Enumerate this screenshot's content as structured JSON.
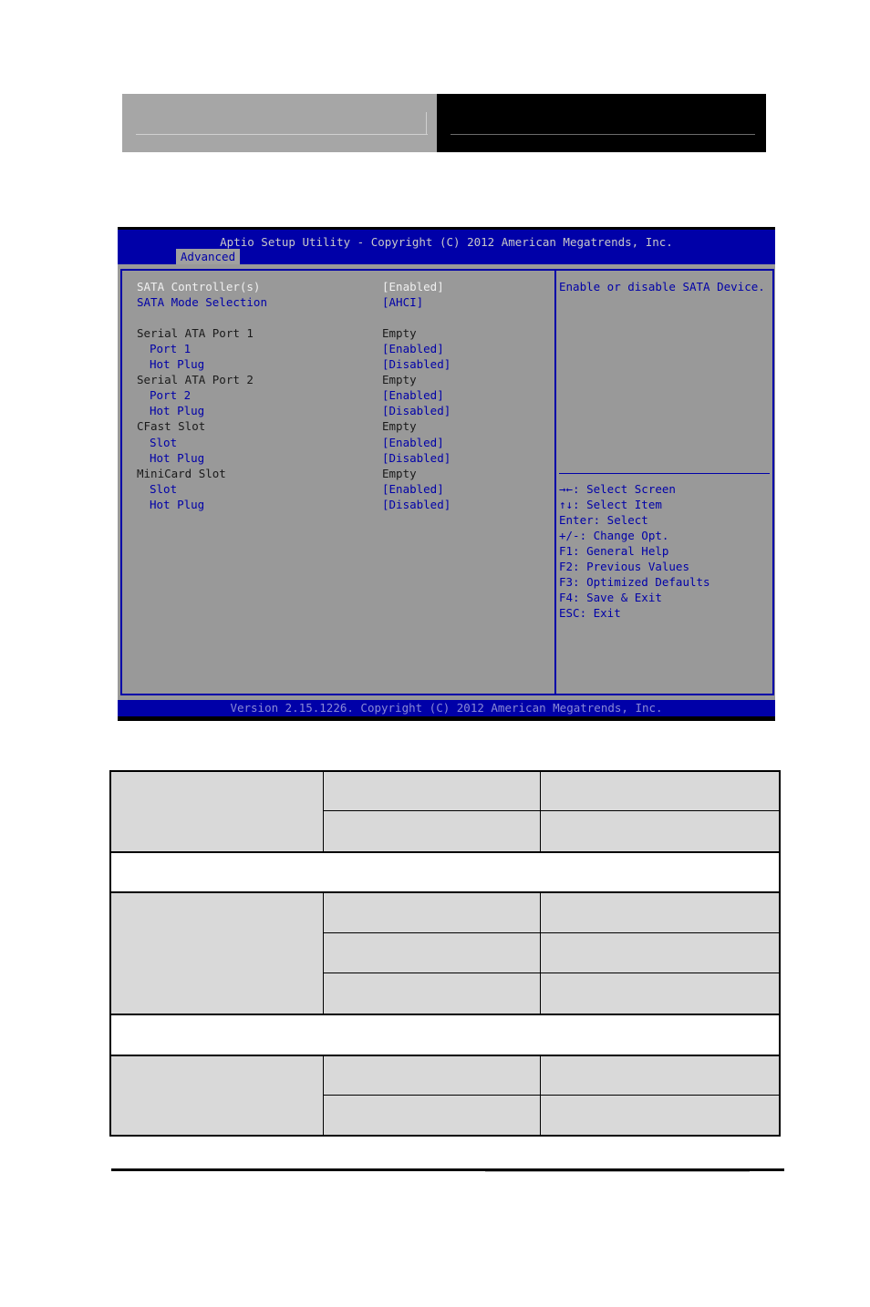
{
  "bios": {
    "title": "Aptio Setup Utility - Copyright (C) 2012 American Megatrends, Inc.",
    "active_tab": "Advanced",
    "settings": [
      {
        "label": "SATA Controller(s)",
        "value": "[Enabled]",
        "indent": false,
        "style": "selected"
      },
      {
        "label": "SATA Mode Selection",
        "value": "[AHCI]",
        "indent": false,
        "style": "option"
      },
      {
        "label": "Serial ATA Port 1",
        "value": "Empty",
        "indent": false,
        "style": "info"
      },
      {
        "label": "Port 1",
        "value": "[Enabled]",
        "indent": true,
        "style": "option"
      },
      {
        "label": "Hot Plug",
        "value": "[Disabled]",
        "indent": true,
        "style": "option"
      },
      {
        "label": "Serial ATA Port 2",
        "value": "Empty",
        "indent": false,
        "style": "info"
      },
      {
        "label": "Port 2",
        "value": "[Enabled]",
        "indent": true,
        "style": "option"
      },
      {
        "label": "Hot Plug",
        "value": "[Disabled]",
        "indent": true,
        "style": "option"
      },
      {
        "label": "CFast Slot",
        "value": "Empty",
        "indent": false,
        "style": "info"
      },
      {
        "label": "Slot",
        "value": "[Enabled]",
        "indent": true,
        "style": "option"
      },
      {
        "label": "Hot Plug",
        "value": "[Disabled]",
        "indent": true,
        "style": "option"
      },
      {
        "label": "MiniCard Slot",
        "value": "Empty",
        "indent": false,
        "style": "info"
      },
      {
        "label": "Slot",
        "value": "[Enabled]",
        "indent": true,
        "style": "option"
      },
      {
        "label": "Hot Plug",
        "value": "[Disabled]",
        "indent": true,
        "style": "option"
      }
    ],
    "help_text": "Enable or disable SATA Device.",
    "key_help": [
      "→←: Select Screen",
      "↑↓: Select Item",
      "Enter: Select",
      "+/-: Change Opt.",
      "F1: General Help",
      "F2: Previous Values",
      "F3: Optimized Defaults",
      "F4: Save & Exit",
      "ESC: Exit"
    ],
    "footer": "Version 2.15.1226. Copyright (C) 2012 American Megatrends, Inc."
  },
  "colors": {
    "bios_blue": "#0000a8",
    "bios_gray": "#999999",
    "table_gray": "#d9d9d9"
  }
}
